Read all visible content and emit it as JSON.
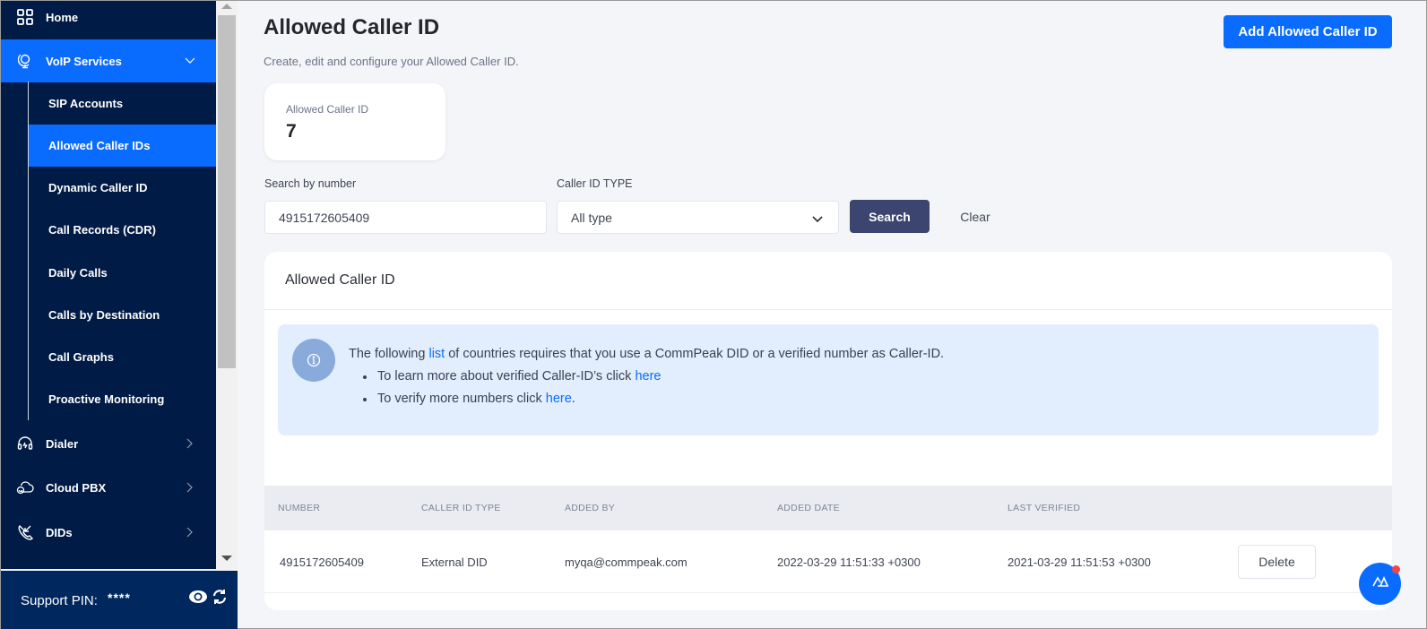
{
  "sidebar": {
    "home": "Home",
    "voip": "VoIP Services",
    "sub_items": [
      "SIP Accounts",
      "Allowed Caller IDs",
      "Dynamic Caller ID",
      "Call Records (CDR)",
      "Daily Calls",
      "Calls by Destination",
      "Call Graphs",
      "Proactive Monitoring"
    ],
    "active_sub_item": "Allowed Caller IDs",
    "dialer": "Dialer",
    "cloud_pbx": "Cloud PBX",
    "dids": "DIDs",
    "support_label": "Support PIN:",
    "support_pin": "****"
  },
  "header": {
    "title": "Allowed Caller ID",
    "subtitle": "Create, edit and configure your Allowed Caller ID.",
    "add_button": "Add Allowed Caller ID"
  },
  "stat": {
    "label": "Allowed Caller ID",
    "value": "7"
  },
  "filters": {
    "search_label": "Search by number",
    "search_value": "4915172605409",
    "type_label": "Caller ID TYPE",
    "type_value": "All type",
    "search_button": "Search",
    "clear_button": "Clear"
  },
  "panel": {
    "title": "Allowed Caller ID",
    "info": {
      "line1_pre": "The following ",
      "line1_link": "list",
      "line1_post": " of countries requires that you use a CommPeak DID or a verified number as Caller-ID.",
      "bullet1_pre": "To learn more about verified Caller-ID’s click ",
      "bullet1_link": "here",
      "bullet2_pre": "To verify more numbers click ",
      "bullet2_link": "here",
      "bullet2_post": "."
    },
    "table": {
      "columns": [
        "NUMBER",
        "CALLER ID TYPE",
        "ADDED BY",
        "ADDED DATE",
        "LAST VERIFIED"
      ],
      "rows": [
        {
          "number": "4915172605409",
          "type": "External DID",
          "added_by": "myqa@commpeak.com",
          "added_date": "2022-03-29 11:51:33 +0300",
          "last_verified": "2021-03-29 11:51:53 +0300",
          "action": "Delete"
        }
      ]
    }
  },
  "colors": {
    "sidebar_bg": "#001b45",
    "accent": "#0a6cff",
    "search_button": "#3b4570",
    "info_bg": "#e2eefd",
    "notification_dot": "#f4434a"
  }
}
